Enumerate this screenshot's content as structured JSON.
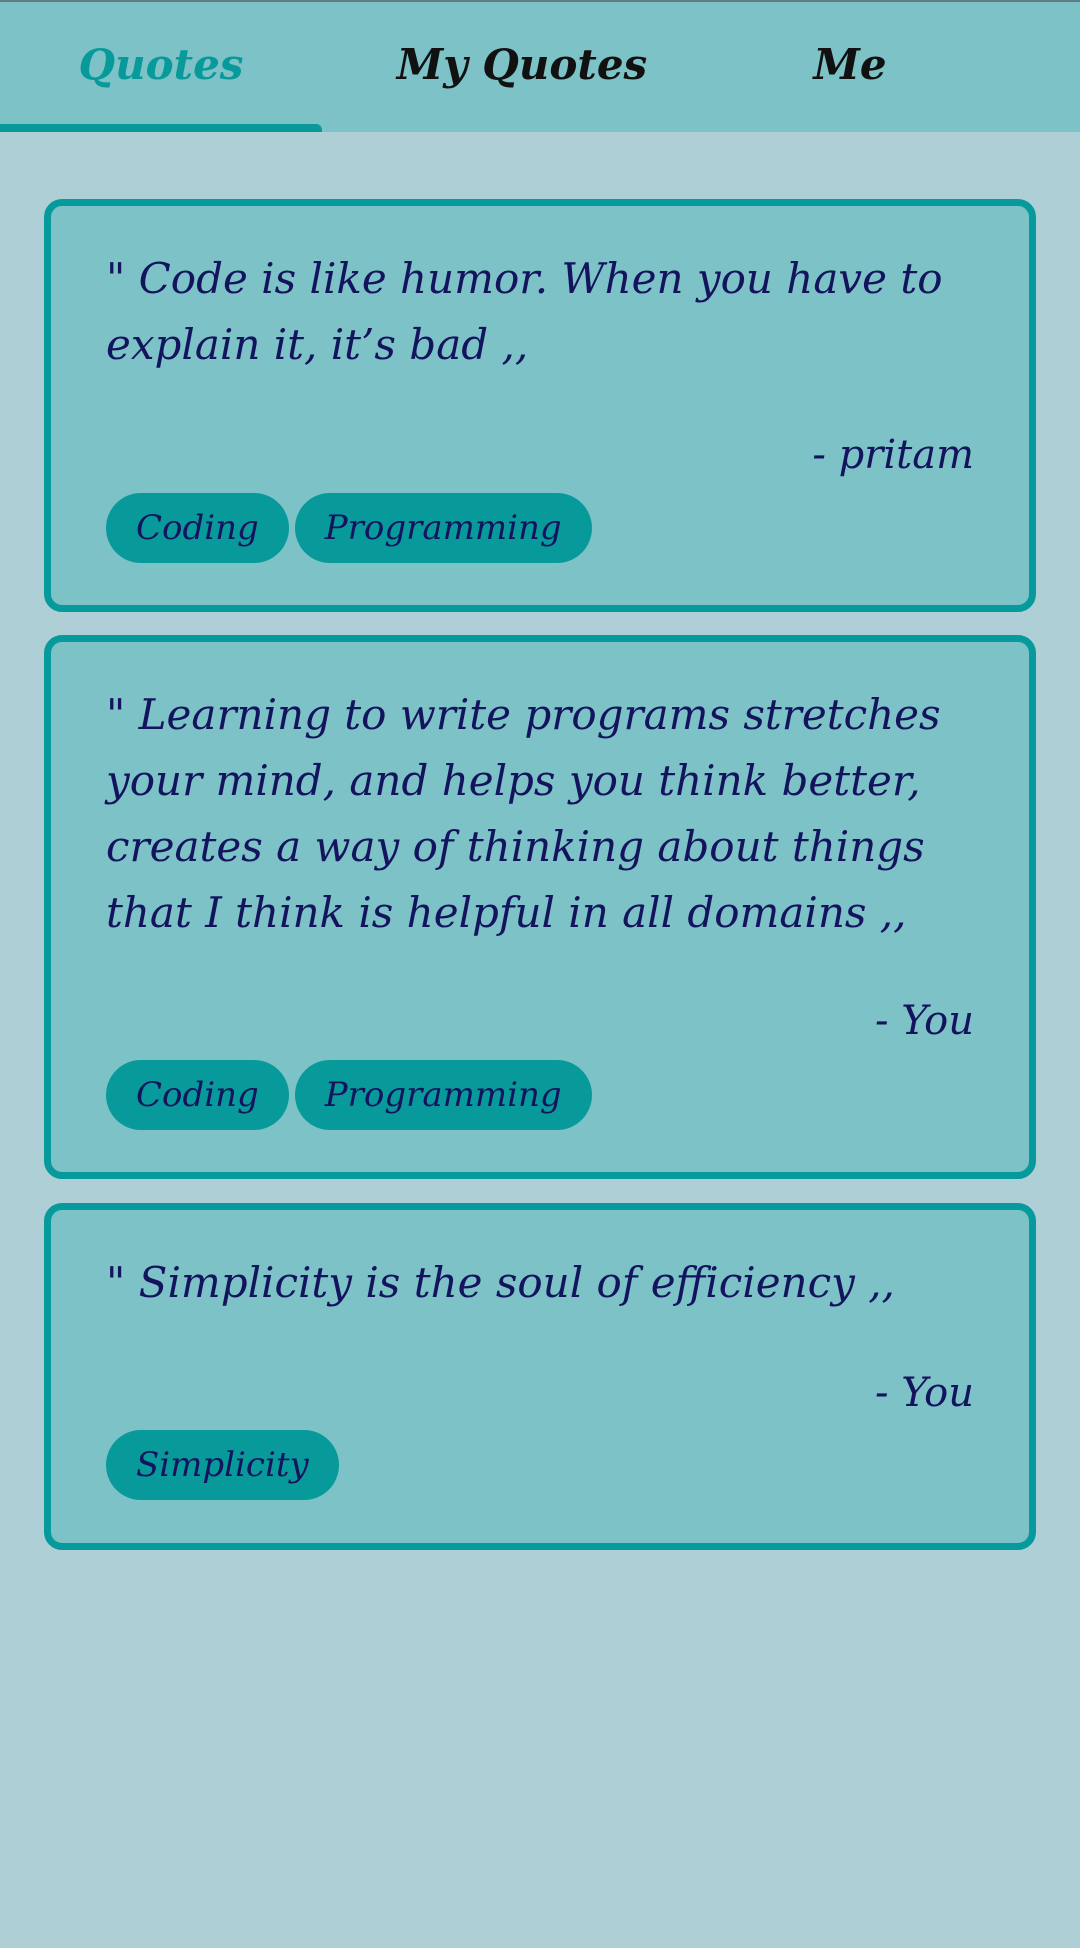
{
  "colors": {
    "background": "#afcfd7",
    "tabbar": "#7cc2c6",
    "accent": "#08999b",
    "text": "#14145e"
  },
  "tabs": [
    {
      "label": "Quotes",
      "active": true
    },
    {
      "label": "My Quotes",
      "active": false
    },
    {
      "label": "Me",
      "active": false
    }
  ],
  "quotes": [
    {
      "text": "\" Code is like humor. When you have to explain it, it’s bad ,,",
      "author": "- pritam",
      "tags": [
        "Coding",
        "Programming"
      ]
    },
    {
      "text": "\" Learning to write programs stretches your mind, and helps you think better, creates a way of thinking about things that I think is helpful in all domains ,,",
      "author": "- You",
      "tags": [
        "Coding",
        "Programming"
      ]
    },
    {
      "text": "\" Simplicity is the soul of efficiency ,,",
      "author": "- You",
      "tags": [
        "Simplicity"
      ]
    }
  ]
}
